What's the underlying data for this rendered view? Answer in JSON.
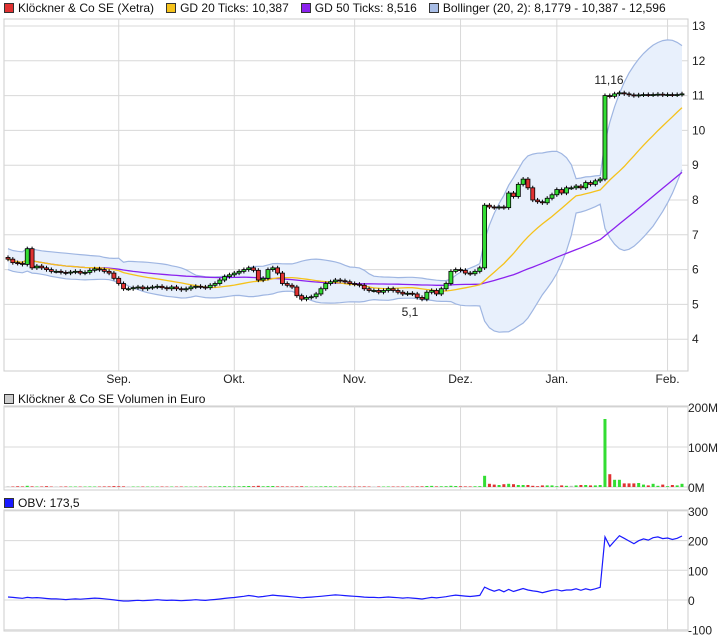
{
  "legend": {
    "main": "Klöckner & Co SE (Xetra)",
    "gd20": "GD 20 Ticks: 10,387",
    "gd50": "GD 50 Ticks: 8,516",
    "bollinger": "Bollinger (20, 2): 8,1779 - 10,387 - 12,596"
  },
  "colors": {
    "up": "#33dd33",
    "down": "#e03232",
    "flat": "#bbbbbb",
    "gd20": "#f5c21b",
    "gd50": "#8b22ee",
    "band_fill": "#e8f0fc",
    "band_stroke": "#9fb6e2",
    "obv": "#1a1aff",
    "grid": "#d8d8d8"
  },
  "volume_panel": {
    "label": "Klöckner & Co SE Volumen in Euro",
    "ticks": [
      "200M",
      "100M",
      "0M"
    ]
  },
  "obv_panel": {
    "label": "OBV: 173,5",
    "ticks": [
      "300",
      "200",
      "100",
      "0",
      "-100"
    ]
  },
  "annotations": {
    "high": "11,16",
    "low": "5,1"
  },
  "chart_data": {
    "type": "candlestick",
    "title": "Klöckner & Co SE (Xetra)",
    "y_ticks": [
      "13",
      "12",
      "11",
      "10",
      "9",
      "8",
      "7",
      "6",
      "5",
      "4"
    ],
    "ylim": [
      3.1,
      13.2
    ],
    "months": [
      {
        "label": "Sep.",
        "index": 23
      },
      {
        "label": "Okt.",
        "index": 47
      },
      {
        "label": "Nov.",
        "index": 72
      },
      {
        "label": "Dez.",
        "index": 94
      },
      {
        "label": "Jan.",
        "index": 114
      },
      {
        "label": "Feb.",
        "index": 137
      }
    ],
    "closes": [
      6.3,
      6.2,
      6.18,
      6.15,
      6.6,
      6.05,
      6.1,
      6.05,
      6.0,
      5.95,
      5.95,
      5.92,
      5.9,
      5.93,
      5.95,
      5.9,
      5.92,
      5.98,
      6.02,
      6.0,
      5.95,
      5.9,
      5.75,
      5.6,
      5.45,
      5.45,
      5.48,
      5.5,
      5.45,
      5.48,
      5.5,
      5.52,
      5.48,
      5.45,
      5.5,
      5.45,
      5.42,
      5.45,
      5.5,
      5.52,
      5.5,
      5.48,
      5.55,
      5.6,
      5.7,
      5.8,
      5.85,
      5.9,
      5.95,
      6.0,
      6.05,
      5.98,
      5.7,
      5.75,
      6.0,
      6.05,
      5.9,
      5.6,
      5.55,
      5.5,
      5.25,
      5.15,
      5.2,
      5.22,
      5.3,
      5.45,
      5.6,
      5.65,
      5.7,
      5.68,
      5.65,
      5.6,
      5.58,
      5.55,
      5.45,
      5.4,
      5.4,
      5.35,
      5.4,
      5.45,
      5.4,
      5.35,
      5.3,
      5.32,
      5.3,
      5.2,
      5.15,
      5.35,
      5.4,
      5.3,
      5.45,
      5.6,
      5.95,
      6.0,
      5.98,
      5.9,
      5.88,
      5.95,
      6.05,
      7.85,
      7.8,
      7.78,
      7.8,
      7.78,
      8.2,
      8.1,
      8.45,
      8.6,
      8.35,
      8.0,
      7.95,
      7.92,
      8.05,
      8.15,
      8.3,
      8.2,
      8.35,
      8.35,
      8.4,
      8.35,
      8.5,
      8.45,
      8.55,
      8.6,
      11.0,
      10.98,
      11.05,
      11.08,
      11.05,
      11.02,
      11.0,
      11.02,
      11.03,
      11.02,
      11.03,
      11.04,
      11.02,
      11.03,
      11.02,
      11.03,
      11.05
    ],
    "volumes_m": [
      1.5,
      1.2,
      1.8,
      1.4,
      3.0,
      1.6,
      1.2,
      1.3,
      2.0,
      1.1,
      1.2,
      1.0,
      1.3,
      1.1,
      1.2,
      1.0,
      1.1,
      1.3,
      1.2,
      1.1,
      1.4,
      1.5,
      2.2,
      1.8,
      1.6,
      1.2,
      1.1,
      1.0,
      1.2,
      1.1,
      1.0,
      1.1,
      1.2,
      1.0,
      1.1,
      1.0,
      1.2,
      1.1,
      1.0,
      1.2,
      1.1,
      1.0,
      1.5,
      1.3,
      1.8,
      2.0,
      1.6,
      1.5,
      1.8,
      2.2,
      2.5,
      2.0,
      3.0,
      1.8,
      2.2,
      2.5,
      1.6,
      1.5,
      1.4,
      1.3,
      1.5,
      1.8,
      1.2,
      1.1,
      1.3,
      1.5,
      1.8,
      1.6,
      1.4,
      1.2,
      1.3,
      1.2,
      1.1,
      1.2,
      1.4,
      1.1,
      1.0,
      1.2,
      1.1,
      1.3,
      1.2,
      1.1,
      1.3,
      1.2,
      1.1,
      1.5,
      1.6,
      2.5,
      2.8,
      1.5,
      1.8,
      2.0,
      3.0,
      2.5,
      1.8,
      1.5,
      1.4,
      1.8,
      2.0,
      28,
      8,
      6,
      5,
      7,
      8,
      7,
      5,
      5,
      5,
      3,
      2,
      4,
      4,
      4,
      2,
      4,
      3,
      3,
      4,
      5,
      5,
      4,
      4,
      5,
      170,
      32,
      18,
      18,
      9,
      9,
      9,
      10,
      6,
      4,
      8,
      3,
      6,
      2,
      5,
      4,
      8
    ],
    "obv_start": 10,
    "sma_periods": [
      20,
      50
    ],
    "bollinger": {
      "period": 20,
      "k": 2
    }
  }
}
